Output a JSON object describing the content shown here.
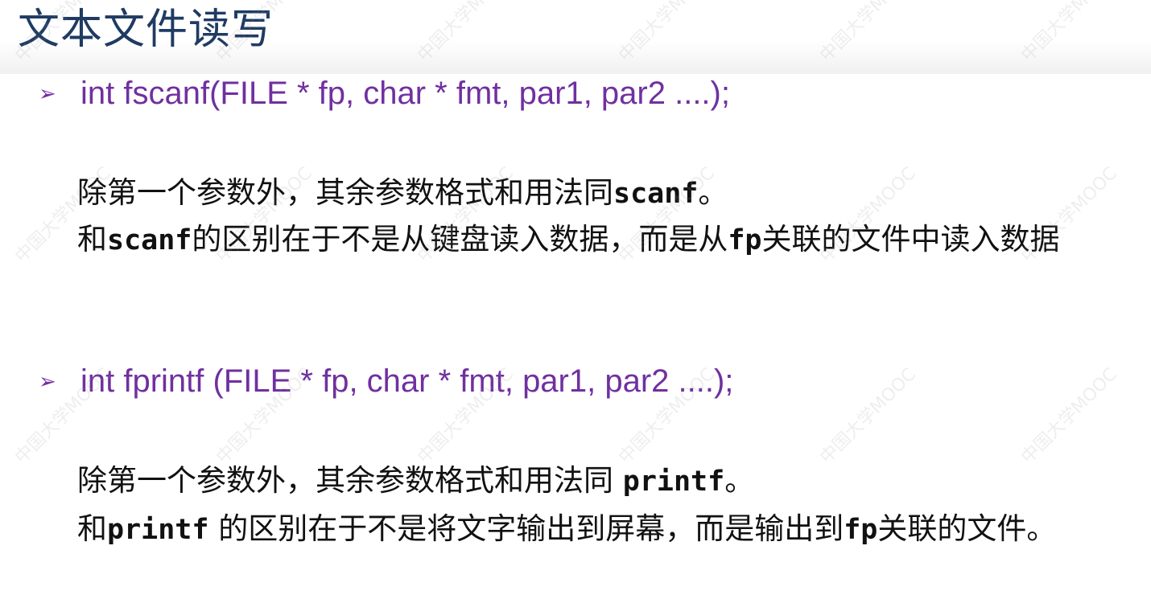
{
  "slide": {
    "title": "文本文件读写",
    "watermark": "中国大学MOOC",
    "bullet_glyph": "➢",
    "sections": [
      {
        "signature": "int  fscanf(FILE * fp, char * fmt,  par1, par2 ....);",
        "line1": {
          "text_a": "除第一个参数外，其余参数格式和用法同",
          "code": "scanf",
          "text_b": "。"
        },
        "line2": {
          "text_a": "和",
          "code_a": "scanf",
          "text_b": "的区别在于不是从键盘读入数据，而是从",
          "code_b": "fp",
          "text_c": "关联的文件中读入数据"
        }
      },
      {
        "signature": "int  fprintf (FILE * fp, char * fmt,  par1, par2 ....);",
        "line1": {
          "text_a": "除第一个参数外，其余参数格式和用法同 ",
          "code": "printf",
          "text_b": "。"
        },
        "line2": {
          "text_a": "和",
          "code_a": "printf",
          "text_b": " 的区别在于不是将文字输出到屏幕，而是输出到",
          "code_b": "fp",
          "text_c": "关联的文件。"
        }
      }
    ]
  }
}
